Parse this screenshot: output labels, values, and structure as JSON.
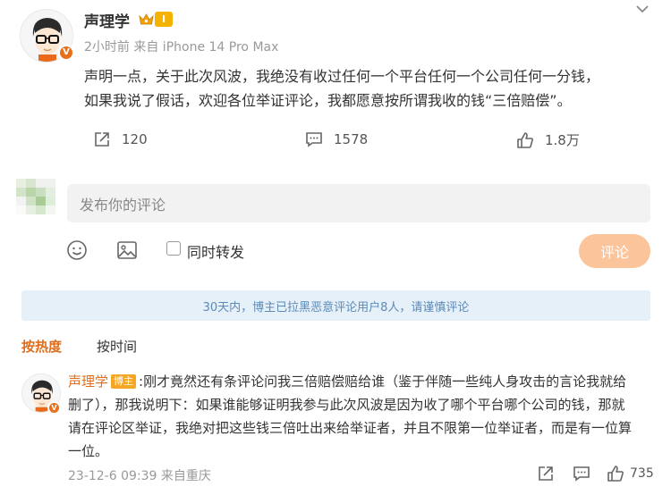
{
  "post": {
    "author": "声理学",
    "level_badge": "I",
    "verified_mark": "V",
    "meta": "2小时前 来自 iPhone 14 Pro Max",
    "text_lines": [
      "声明一点，关于此次风波，我绝没有收过任何一个平台任何一个公司任何一分钱，",
      "如果我说了假话，欢迎各位举证评论，我都愿意按所谓我收的钱“三倍赔偿”。"
    ]
  },
  "actions": {
    "repost_count": "120",
    "comment_count": "1578",
    "like_count": "1.8万"
  },
  "composer": {
    "placeholder": "发布你的评论",
    "repost_checkbox_label": "同时转发",
    "submit_label": "评论"
  },
  "notice": "30天内，博主已拉黑恶意评论用户8人，请谨慎评论",
  "sort_tabs": [
    "按热度",
    "按时间"
  ],
  "top_comment": {
    "author": "声理学",
    "badge": "博主",
    "verified_mark": "V",
    "lines": [
      ":刚才竟然还有条评论问我三倍赔偿赔给谁（鉴于伴随一些纯人身攻击的言论我就给",
      "删了），那我说明下：如果谁能够证明我参与此次风波是因为收了哪个平台哪个公司的钱，那就",
      "请在评论区举证，我绝对把这些钱三倍吐出来给举证者，并且不限第一位举证者，而是有一位算",
      "一位。"
    ],
    "meta": "23-12-6 09:39 来自重庆",
    "like_count": "735"
  },
  "colors": {
    "accent": "#e06d1b",
    "submit_button": "#fbc49a",
    "notice_bg": "#e6f0f8",
    "notice_text": "#5c8ab8"
  },
  "icons": [
    "chevron-down-icon",
    "crown-icon",
    "repost-icon",
    "comment-icon",
    "like-icon",
    "emoji-icon",
    "image-icon",
    "share-icon"
  ]
}
